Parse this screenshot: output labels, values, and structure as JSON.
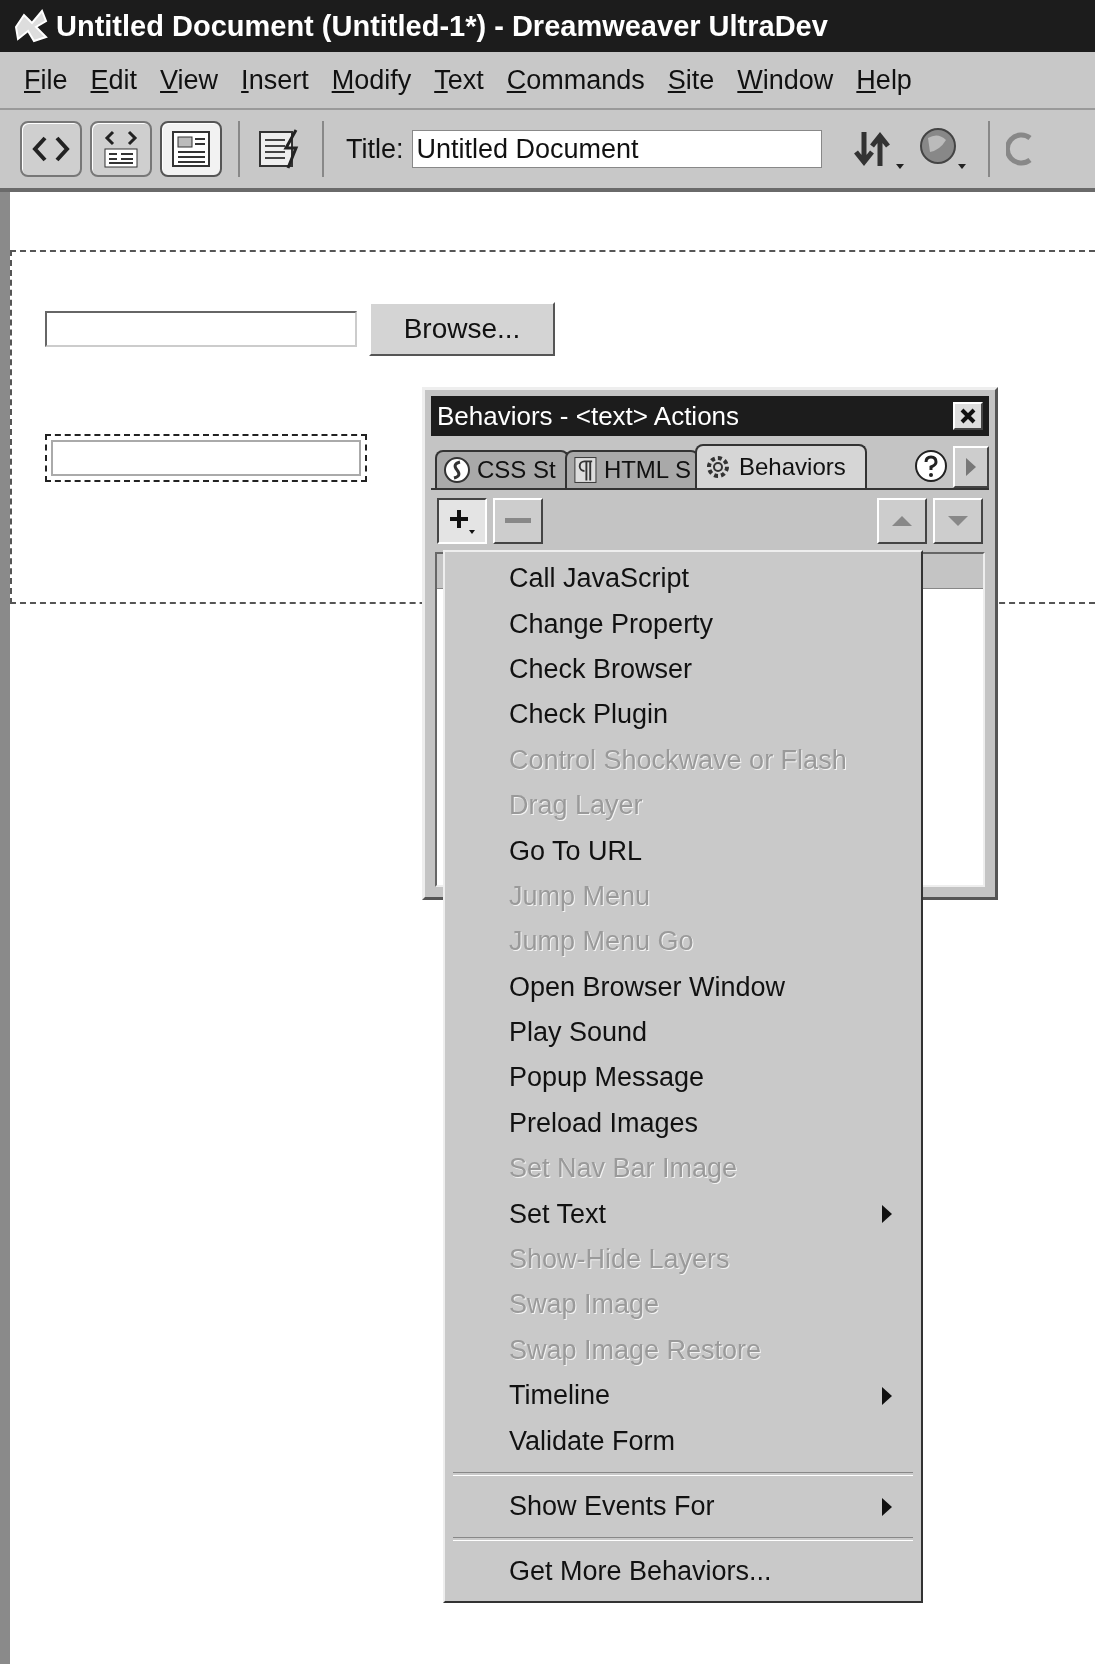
{
  "window": {
    "title": "Untitled Document (Untitled-1*) - Dreamweaver UltraDev"
  },
  "menu_bar": [
    {
      "label": "File"
    },
    {
      "label": "Edit"
    },
    {
      "label": "View"
    },
    {
      "label": "Insert"
    },
    {
      "label": "Modify"
    },
    {
      "label": "Text"
    },
    {
      "label": "Commands"
    },
    {
      "label": "Site"
    },
    {
      "label": "Window"
    },
    {
      "label": "Help"
    }
  ],
  "toolbar": {
    "view_buttons": [
      {
        "selected": false
      },
      {
        "selected": false
      },
      {
        "selected": true
      }
    ],
    "title_label": "Title:",
    "title_value": "Untitled Document"
  },
  "document": {
    "file_field": {
      "button": "Browse..."
    },
    "text_field": {
      "selected": true
    }
  },
  "behaviors_panel": {
    "title": "Behaviors - <text> Actions",
    "tabs": [
      {
        "label": "CSS St",
        "selected": false
      },
      {
        "label": "HTML S",
        "selected": false
      },
      {
        "label": "Behaviors",
        "selected": true
      }
    ],
    "add_pressed": true,
    "menu": [
      {
        "kind": "item",
        "label": "Call JavaScript",
        "disabled": false,
        "submenu": false
      },
      {
        "kind": "item",
        "label": "Change Property",
        "disabled": false,
        "submenu": false
      },
      {
        "kind": "item",
        "label": "Check Browser",
        "disabled": false,
        "submenu": false
      },
      {
        "kind": "item",
        "label": "Check Plugin",
        "disabled": false,
        "submenu": false
      },
      {
        "kind": "item",
        "label": "Control Shockwave or Flash",
        "disabled": true,
        "submenu": false
      },
      {
        "kind": "item",
        "label": "Drag Layer",
        "disabled": true,
        "submenu": false
      },
      {
        "kind": "item",
        "label": "Go To URL",
        "disabled": false,
        "submenu": false
      },
      {
        "kind": "item",
        "label": "Jump Menu",
        "disabled": true,
        "submenu": false
      },
      {
        "kind": "item",
        "label": "Jump Menu Go",
        "disabled": true,
        "submenu": false
      },
      {
        "kind": "item",
        "label": "Open Browser Window",
        "disabled": false,
        "submenu": false
      },
      {
        "kind": "item",
        "label": "Play Sound",
        "disabled": false,
        "submenu": false
      },
      {
        "kind": "item",
        "label": "Popup Message",
        "disabled": false,
        "submenu": false
      },
      {
        "kind": "item",
        "label": "Preload Images",
        "disabled": false,
        "submenu": false
      },
      {
        "kind": "item",
        "label": "Set Nav Bar Image",
        "disabled": true,
        "submenu": false
      },
      {
        "kind": "item",
        "label": "Set Text",
        "disabled": false,
        "submenu": true
      },
      {
        "kind": "item",
        "label": "Show-Hide Layers",
        "disabled": true,
        "submenu": false
      },
      {
        "kind": "item",
        "label": "Swap Image",
        "disabled": true,
        "submenu": false
      },
      {
        "kind": "item",
        "label": "Swap Image Restore",
        "disabled": true,
        "submenu": false
      },
      {
        "kind": "item",
        "label": "Timeline",
        "disabled": false,
        "submenu": true
      },
      {
        "kind": "item",
        "label": "Validate Form",
        "disabled": false,
        "submenu": false
      },
      {
        "kind": "separator"
      },
      {
        "kind": "item",
        "label": "Show Events For",
        "disabled": false,
        "submenu": true
      },
      {
        "kind": "separator"
      },
      {
        "kind": "item",
        "label": "Get More Behaviors...",
        "disabled": false,
        "submenu": false
      }
    ]
  }
}
